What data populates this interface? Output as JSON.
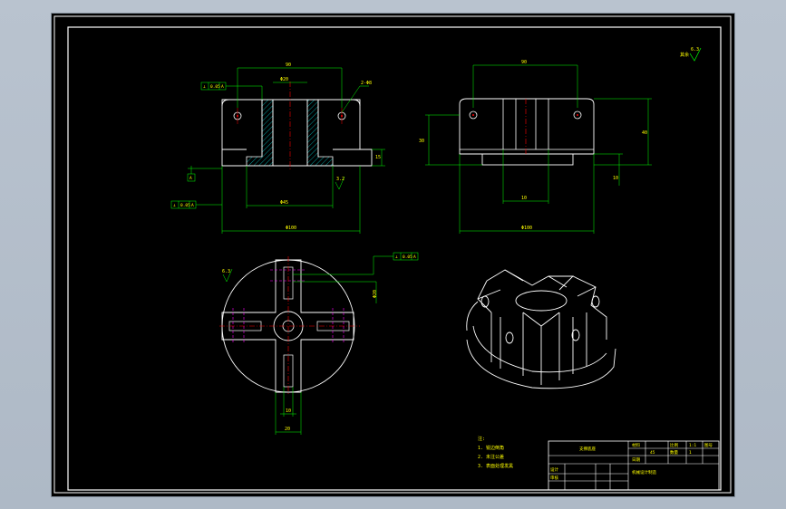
{
  "drawing": {
    "roughness_symbol": "其余",
    "roughness_value": "6.3",
    "colors": {
      "background": "#000000",
      "outline": "#ffffff",
      "dimension": "#00ff00",
      "text": "#ffff00",
      "centerline": "#ff0000",
      "hidden": "#ff00ff",
      "section": "#00ffff"
    }
  },
  "front_view": {
    "dim_top": "90",
    "dim_bore": "Φ20",
    "dim_bottom_bore": "Φ45",
    "dim_overall": "Φ100",
    "dim_height": "15",
    "gdt_top": [
      "⊥",
      "0.05",
      "A"
    ],
    "gdt_bottom": [
      "⊥",
      "0.05",
      "A"
    ],
    "datum": "A",
    "surface_mark": "3.2"
  },
  "side_view": {
    "dim_top": "90",
    "dim_height": "40",
    "dim_left": "30",
    "dim_slot": "10",
    "dim_overall": "Φ100",
    "dim_step": "10"
  },
  "top_view": {
    "gdt": [
      "⊥",
      "0.05",
      "A"
    ],
    "dim_bore": "Φ20",
    "dim_slot": "10",
    "dim_width": "20",
    "surface_mark": "6.3"
  },
  "notes": {
    "heading": "注:",
    "items": [
      "1. 锐边倒角",
      "2. 未注公差",
      "3. 表面处理发黑"
    ]
  },
  "title_block": {
    "part_name": "支撑底座",
    "school": "机械设计制造",
    "material_label": "材料",
    "material_value": "45",
    "scale_label": "比例",
    "scale_value": "1:1",
    "quantity_label": "数量",
    "quantity_value": "1",
    "sheet_label": "图号",
    "designer_label": "设计",
    "checker_label": "审核",
    "date_label": "日期"
  }
}
